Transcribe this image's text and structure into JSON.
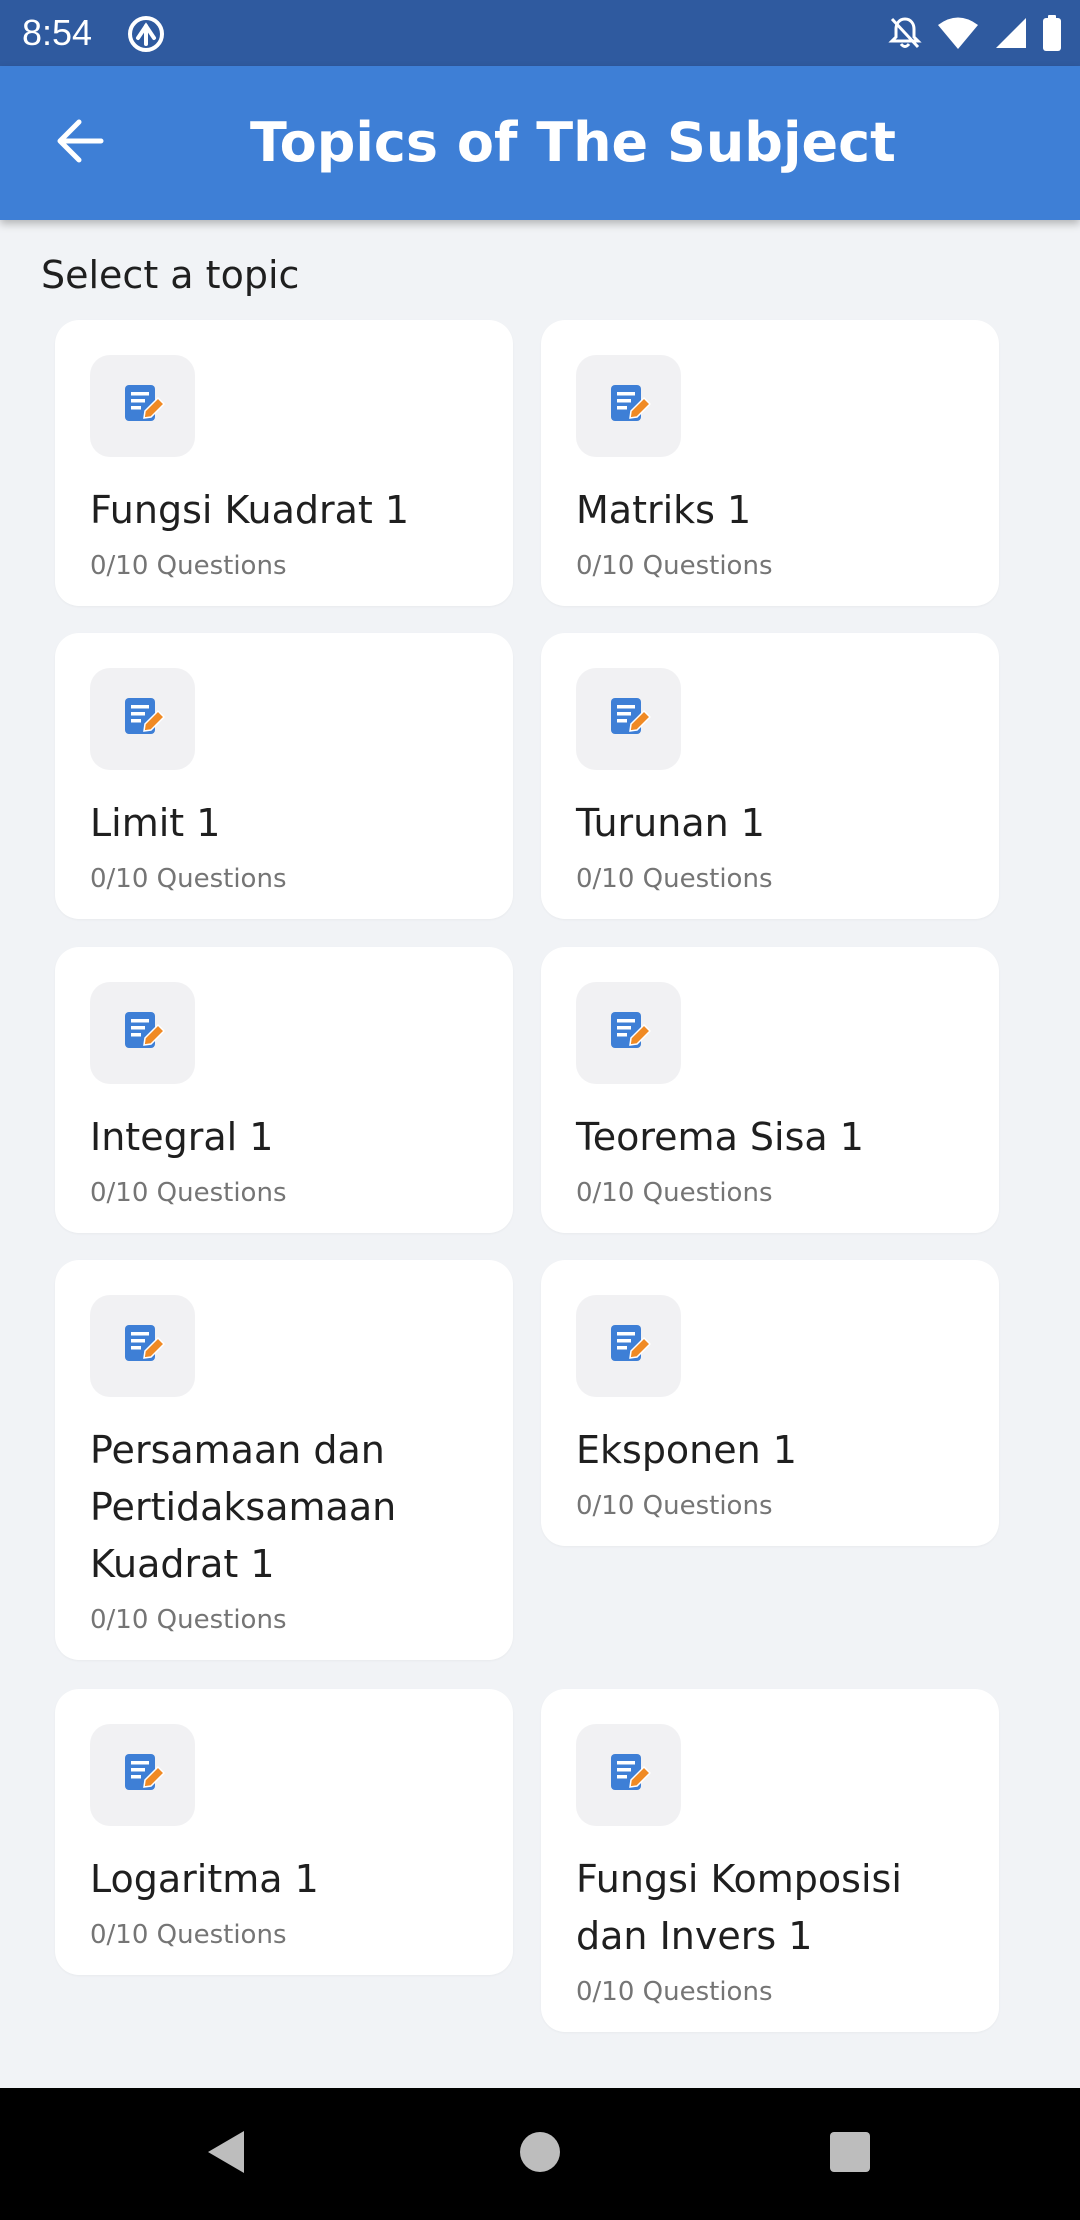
{
  "status_bar": {
    "time": "8:54"
  },
  "app_bar": {
    "title": "Topics of The Subject",
    "background": "#3e7fd6"
  },
  "main": {
    "section_title": "Select a topic",
    "topics": [
      {
        "title": "Fungsi Kuadrat 1",
        "progress": "0/10 Questions"
      },
      {
        "title": "Matriks 1",
        "progress": "0/10 Questions"
      },
      {
        "title": "Limit 1",
        "progress": "0/10 Questions"
      },
      {
        "title": "Turunan 1",
        "progress": "0/10 Questions"
      },
      {
        "title": "Integral 1",
        "progress": "0/10 Questions"
      },
      {
        "title": "Teorema Sisa 1",
        "progress": "0/10 Questions"
      },
      {
        "title": "Persamaan dan Pertidaksamaan Kuadrat 1",
        "progress": "0/10 Questions"
      },
      {
        "title": "Eksponen 1",
        "progress": "0/10 Questions"
      },
      {
        "title": "Logaritma 1",
        "progress": "0/10 Questions"
      },
      {
        "title": "Fungsi Komposisi dan Invers 1",
        "progress": "0/10 Questions"
      }
    ],
    "topic_icon": "edit-document-icon",
    "icon_colors": {
      "document": "#3e7fd6",
      "pencil": "#f08a24"
    }
  },
  "nav_bar": {
    "icons": [
      "back-triangle-icon",
      "home-circle-icon",
      "recents-square-icon"
    ]
  }
}
